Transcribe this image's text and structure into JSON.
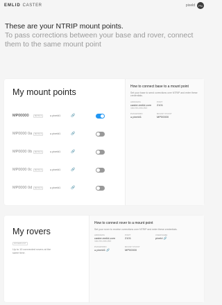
{
  "brand": {
    "logo": "EMLID",
    "product": "CASTER"
  },
  "user": {
    "name": "pixeld",
    "avatar": "PN"
  },
  "hero": {
    "line1": "These are your NTRIP mount points.",
    "line2": "To pass corrections between your base and rover, connect them to the same mount point"
  },
  "mounts": {
    "title": "My mount points",
    "chip_label": "DETAILS",
    "rows": [
      {
        "name": "MP00000",
        "password": "pixeld1",
        "active": true
      },
      {
        "name": "MP0000 0a",
        "password": "pixeld1",
        "active": false
      },
      {
        "name": "MP0000 0b",
        "password": "pixeld1",
        "active": false
      },
      {
        "name": "MP0000 0c",
        "password": "pixeld1",
        "active": false
      },
      {
        "name": "MP0000 0d",
        "password": "pixeld1",
        "active": false
      }
    ],
    "side": {
      "title": "How to connect base to a mount point",
      "desc": "Set your base to send corrections over NTRIP and enter these credentials.",
      "address_label": "ADDRESS",
      "address": "caster.emlid.com",
      "address_ip": "164.90.245.252",
      "port_label": "PORT",
      "port": "2101",
      "password_label": "PASSWORD",
      "password": "pixeld1",
      "mount_label": "MOUNT POINT",
      "mount": "MP00000"
    }
  },
  "rovers": {
    "title": "My rovers",
    "chip_label": "ROVERS LIST",
    "note": "Up to 10 connected rovers at the same time.",
    "side": {
      "title": "How to connect rover to a mount point",
      "desc": "Set your rover to receive corrections over NTRIP and enter these credentials.",
      "address_label": "ADDRESS",
      "address": "caster.emlid.com",
      "address_ip": "164.90.245.252",
      "port_label": "PORT",
      "port": "2101",
      "username_label": "USERNAME",
      "username": "pixeld",
      "password_label": "PASSWORD",
      "password": "pixeld1",
      "mount_label": "MOUNT POINT",
      "mount": "MP00000"
    }
  },
  "colors": {
    "accent": "#2196f3",
    "toggle_off": "#999999"
  }
}
